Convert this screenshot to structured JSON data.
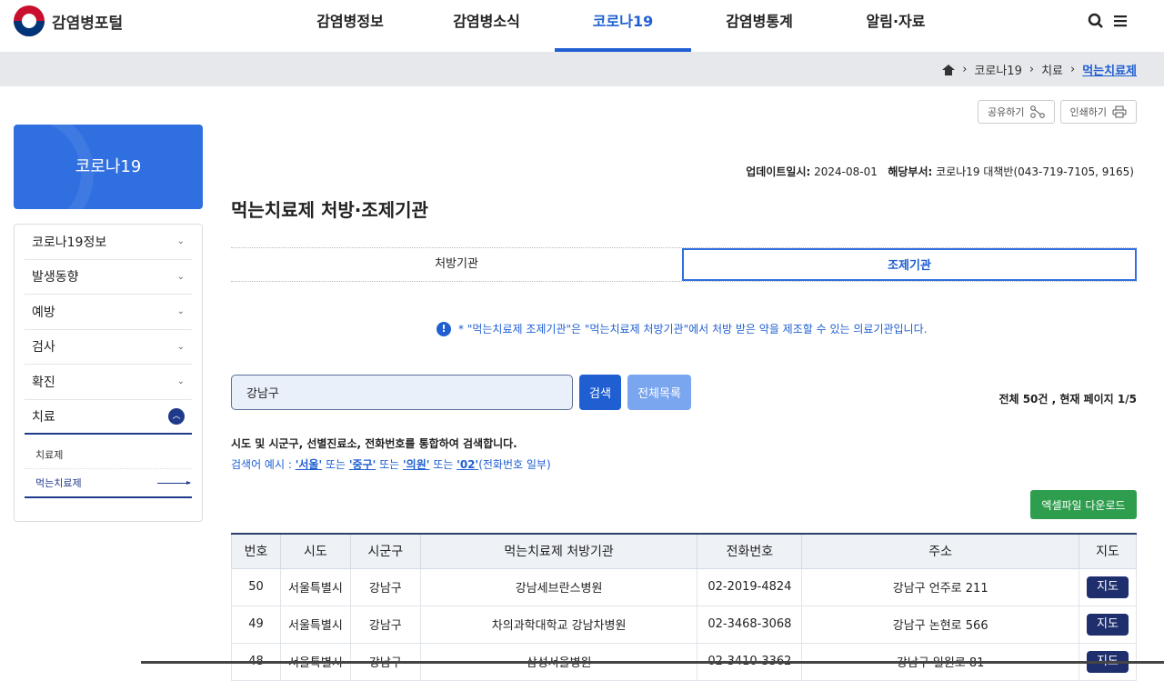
{
  "header": {
    "logo_text": "감염병포털",
    "nav": [
      "감염병정보",
      "감염병소식",
      "코로나19",
      "감염병통계",
      "알림·자료"
    ],
    "active_nav": 2,
    "search_icon": "search-icon",
    "menu_icon": "menu-icon"
  },
  "breadcrumb": {
    "items": [
      "코로나19",
      "치료"
    ],
    "current": "먹는치료제"
  },
  "share": {
    "share_label": "공유하기",
    "print_label": "인쇄하기"
  },
  "sidebar": {
    "hero": "코로나19",
    "items": [
      {
        "label": "코로나19정보"
      },
      {
        "label": "발생동향"
      },
      {
        "label": "예방"
      },
      {
        "label": "검사"
      },
      {
        "label": "확진"
      },
      {
        "label": "치료"
      }
    ],
    "sub_items": [
      "치료제",
      "먹는치료제"
    ]
  },
  "update": {
    "date_label": "업데이트일시:",
    "date": "2024-08-01",
    "dept_label": "해당부서:",
    "dept": "코로나19 대책반(043-719-7105, 9165)"
  },
  "page_title": "먹는치료제 처방·조제기관",
  "tabs": [
    "처방기관",
    "조제기관"
  ],
  "notice": "* \"먹는치료제 조제기관\"은 \"먹는치료제 처방기관\"에서 처방 받은 약을 제조할 수 있는 의료기관입니다.",
  "search": {
    "value": "강남구",
    "search_label": "검색",
    "all_label": "전체목록"
  },
  "count_text": "전체 50건 , 현재 페이지 1/5",
  "help": {
    "line1": "시도 및 시군구, 선별진료소, 전화번호를 통합하여 검색합니다.",
    "prefix": "검색어 예시 : ",
    "kw1": "'서울'",
    "or1": " 또는 ",
    "kw2": "'중구'",
    "or2": " 또는 ",
    "kw3": "'의원'",
    "or3": " 또는 ",
    "kw4": "'02'",
    "suffix": "(전화번호 일부)"
  },
  "excel_label": "엑셀파일 다운로드",
  "table": {
    "headers": [
      "번호",
      "시도",
      "시군구",
      "먹는치료제 처방기관",
      "전화번호",
      "주소",
      "지도"
    ],
    "rows": [
      {
        "no": "50",
        "sido": "서울특별시",
        "sigungu": "강남구",
        "name": "강남세브란스병원",
        "tel": "02-2019-4824",
        "addr": "강남구 언주로 211",
        "map": "지도"
      },
      {
        "no": "49",
        "sido": "서울특별시",
        "sigungu": "강남구",
        "name": "차의과학대학교 강남차병원",
        "tel": "02-3468-3068",
        "addr": "강남구 논현로 566",
        "map": "지도"
      },
      {
        "no": "48",
        "sido": "서울특별시",
        "sigungu": "강남구",
        "name": "삼성서울병원",
        "tel": "02-3410-3362",
        "addr": "강남구 일원로 81",
        "map": "지도"
      }
    ]
  }
}
